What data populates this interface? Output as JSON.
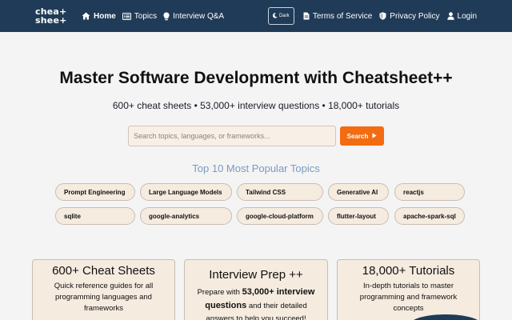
{
  "brand": {
    "logo_line1": "chea+",
    "logo_line2": "shee+"
  },
  "nav": {
    "home": "Home",
    "topics": "Topics",
    "interview": "Interview Q&A",
    "dark": "Dark",
    "terms": "Terms of Service",
    "privacy": "Privacy Policy",
    "login": "Login"
  },
  "hero": {
    "title": "Master Software Development with Cheatsheet++",
    "subtitle": "600+ cheat sheets • 53,000+ interview questions • 18,000+ tutorials"
  },
  "search": {
    "placeholder": "Search topics, languages, or frameworks...",
    "button": "Search"
  },
  "popular": {
    "title": "Top 10 Most Popular Topics",
    "topics": [
      "Prompt Engineering",
      "Large Language Models",
      "Tailwind CSS",
      "Generative AI",
      "reactjs",
      "sqlite",
      "google-analytics",
      "google-cloud-platform",
      "flutter-layout",
      "apache-spark-sql"
    ]
  },
  "cards": [
    {
      "title": "600+ Cheat Sheets",
      "desc": "Quick reference guides for all programming languages and frameworks"
    },
    {
      "title": "Interview Prep ++",
      "desc_pre": "Prepare with ",
      "desc_strong": "53,000+ interview questions",
      "desc_post": " and their detailed answers to help you succeed!"
    },
    {
      "title": "18,000+ Tutorials",
      "desc": "In-depth tutorials to master programming and framework concepts"
    }
  ],
  "colors": {
    "navbar": "#1f3b57",
    "accent": "#f36c12",
    "card_bg": "#f6ebdf",
    "popular_title": "#7a9bbf"
  },
  "icons": [
    "home-icon",
    "list-icon",
    "lightbulb-icon",
    "moon-icon",
    "document-icon",
    "shield-icon",
    "user-icon",
    "play-icon"
  ]
}
